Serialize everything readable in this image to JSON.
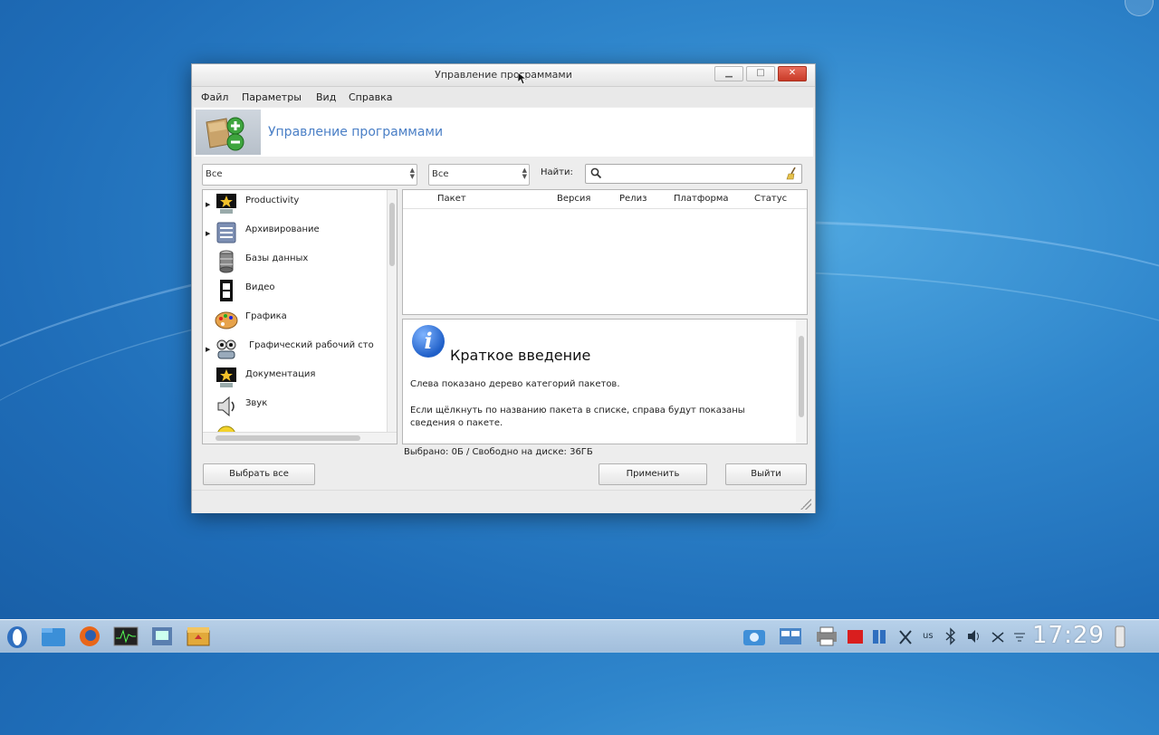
{
  "window": {
    "title": "Управление программами",
    "controls": {
      "minimize": "▁",
      "maximize": "□",
      "close": "✕"
    }
  },
  "menu": [
    "Файл",
    "Параметры",
    "Вид",
    "Справка"
  ],
  "banner": {
    "title": "Управление программами"
  },
  "filters": {
    "category": "Все",
    "status": "Все",
    "find_label": "Найти:",
    "search_value": ""
  },
  "tree": {
    "items": [
      {
        "label": "Productivity",
        "expandable": true,
        "icon": "productivity-icon"
      },
      {
        "label": "Архивирование",
        "expandable": true,
        "icon": "archive-icon"
      },
      {
        "label": "Базы данных",
        "expandable": false,
        "icon": "database-icon"
      },
      {
        "label": "Видео",
        "expandable": false,
        "icon": "video-icon"
      },
      {
        "label": "Графика",
        "expandable": false,
        "icon": "graphics-icon"
      },
      {
        "label": "Графический рабочий сто",
        "expandable": true,
        "icon": "desktop-icon"
      },
      {
        "label": "Документация",
        "expandable": false,
        "icon": "documentation-icon"
      },
      {
        "label": "Звук",
        "expandable": false,
        "icon": "sound-icon"
      }
    ]
  },
  "table": {
    "columns": [
      "Пакет",
      "Версия",
      "Релиз",
      "Платформа",
      "Статус"
    ]
  },
  "info": {
    "title": "Краткое введение",
    "p1": "Слева показано дерево категорий пакетов.",
    "p2": "Если щёлкнуть по названию пакета в списке, справа будут показаны сведения о пакете."
  },
  "status_text": "Выбрано: 0Б / Свободно на диске: 36ГБ",
  "buttons": {
    "select_all": "Выбрать все",
    "apply": "Применить",
    "quit": "Выйти"
  },
  "taskbar": {
    "clock": "17:29",
    "keyboard_layout": "us"
  },
  "colors": {
    "accent": "#4a7fc6",
    "close_button": "#d9452f",
    "desktop": "#2f86cc"
  }
}
